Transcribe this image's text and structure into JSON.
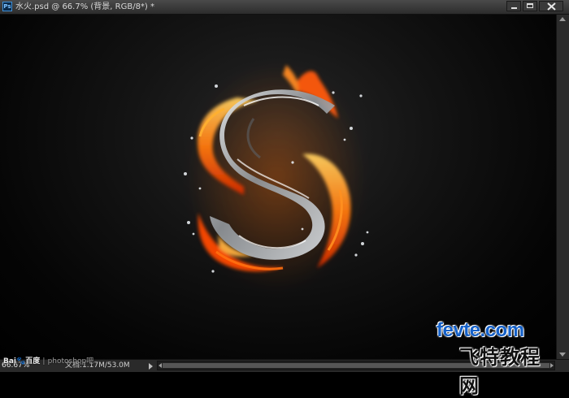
{
  "window": {
    "title": "水火.psd @ 66.7% (背景, RGB/8*) *",
    "app_icon_label": "Ps",
    "icons": {
      "minimize": "minimize-icon",
      "maximize": "maximize-icon",
      "close": "close-icon"
    }
  },
  "canvas": {
    "content": "water-fire-letter-s-artwork",
    "background_color": "#0b0b0b",
    "fire_colors": [
      "#ff3a00",
      "#ff7a10",
      "#ffc040"
    ],
    "water_color": "#c8ccd0"
  },
  "statusbar": {
    "zoom": "66.67%",
    "doc_info": "文档:1.17M/53.0M"
  },
  "watermarks": {
    "baidu_brand": "Bai",
    "baidu_paw": "🐾",
    "baidu_suffix": "百度",
    "separator": "|",
    "baidu_site": "photoshop吧",
    "fevte_en": "fevte.com",
    "fevte_cn": "飞特教程网"
  }
}
